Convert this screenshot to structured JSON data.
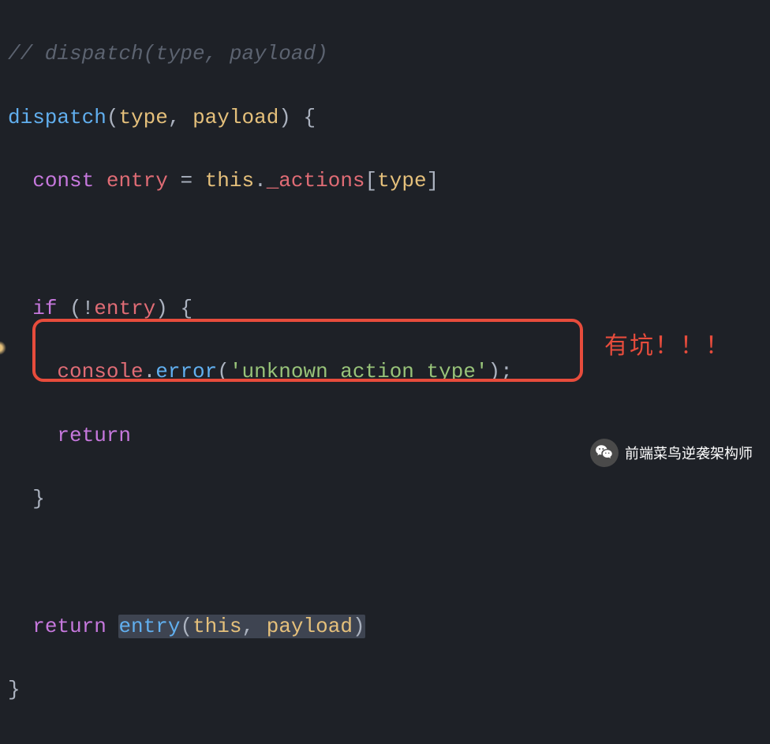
{
  "code": {
    "line1_comment": "// dispatch(type, payload)",
    "line2_fn": "dispatch",
    "line2_p1": "type",
    "line2_p2": "payload",
    "line3_const": "const",
    "line3_var": "entry",
    "line3_eq": " = ",
    "line3_this": "this",
    "line3_dot": ".",
    "line3_prop": "_actions",
    "line3_br_open": "[",
    "line3_idx": "type",
    "line3_br_close": "]",
    "line5_if": "if",
    "line5_neg": "!",
    "line5_cond": "entry",
    "line6_obj": "console",
    "line6_method": "error",
    "line6_str": "'unknown action type'",
    "line7_return": "return",
    "line10_return": "return",
    "line10_fn": "entry",
    "line10_arg1": "this",
    "line10_arg2": "payload"
  },
  "annotation": "有坑！！！",
  "watermark": "前端菜鸟逆袭架构师"
}
